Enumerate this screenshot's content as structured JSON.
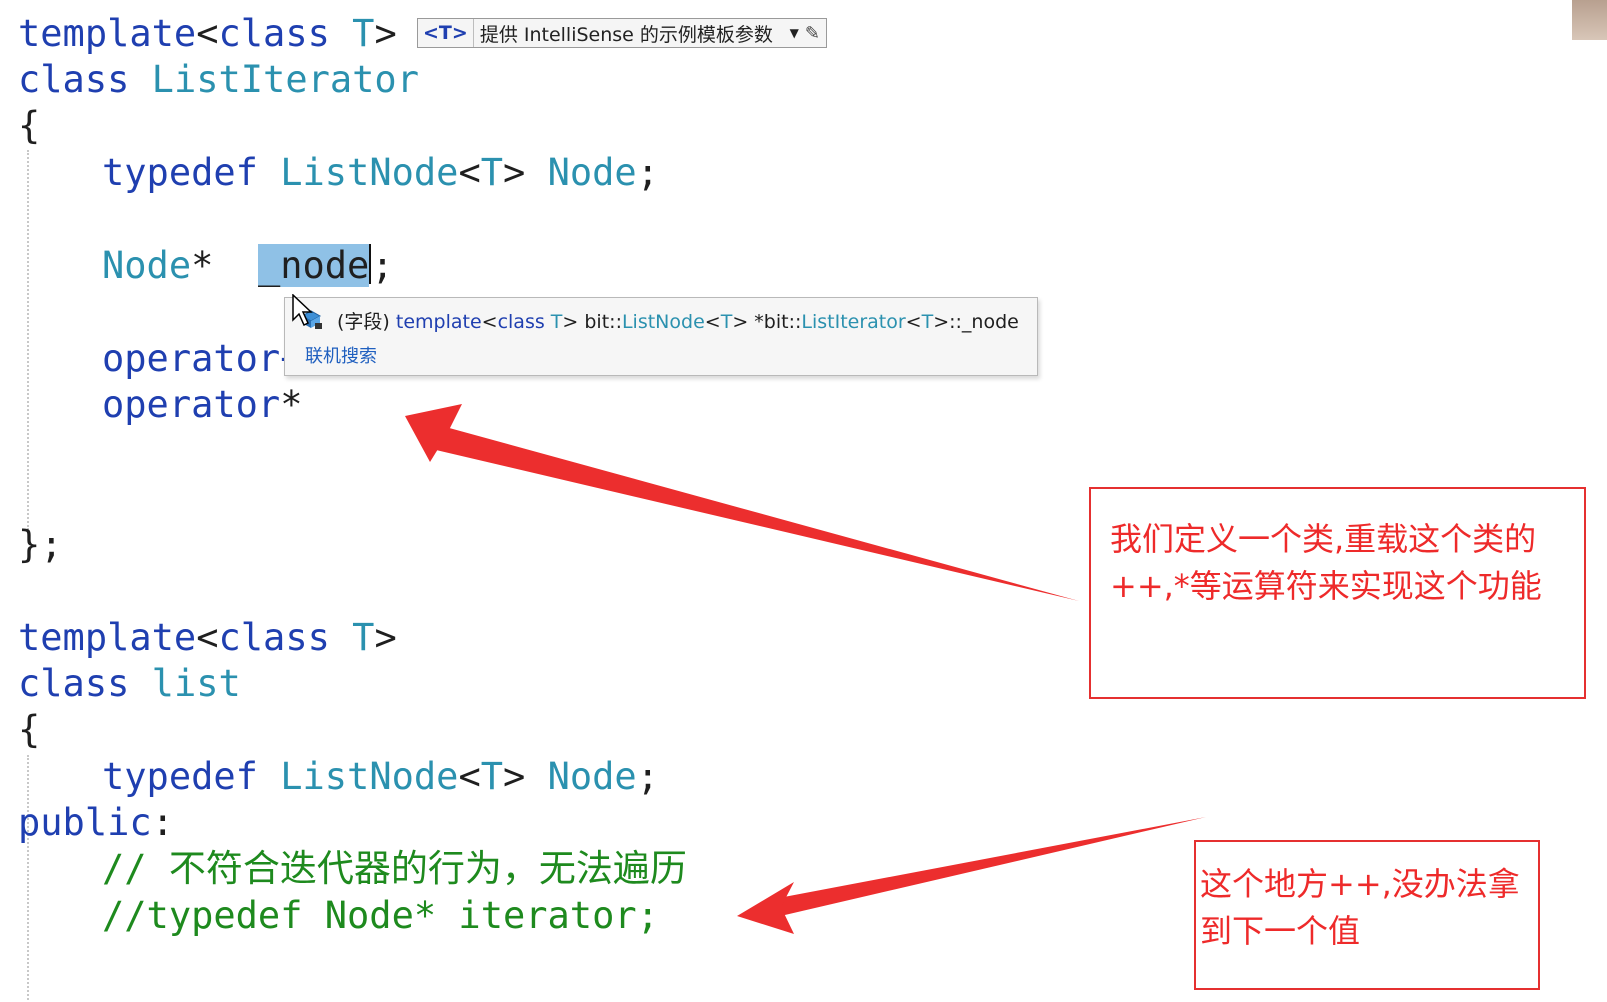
{
  "code_top": {
    "line1": {
      "kw": "template",
      "p1": "<",
      "kw2": "class",
      "sp": " ",
      "t": "T",
      "p2": ">"
    },
    "line2": {
      "kw": "class",
      "name": "ListIterator"
    },
    "line3": "{",
    "line4": {
      "kw": "typedef",
      "type": "ListNode",
      "p1": "<",
      "t": "T",
      "p2": ">",
      "name": "Node",
      "end": ";"
    },
    "line5": {
      "type": "Node",
      "star": "*",
      "field": "_node",
      "end": ";"
    },
    "line6": {
      "kw": "operator+",
      "rest": "+"
    },
    "line7": {
      "kw": "operator",
      "rest": "*"
    },
    "line8": "};"
  },
  "code_bottom": {
    "line1": {
      "kw": "template",
      "p1": "<",
      "kw2": "class",
      "t": "T",
      "p2": ">"
    },
    "line2": {
      "kw": "class",
      "name": "list"
    },
    "line3": "{",
    "line4": {
      "kw": "typedef",
      "type": "ListNode",
      "p1": "<",
      "t": "T",
      "p2": ">",
      "name": "Node",
      "end": ";"
    },
    "line5": {
      "kw": "public",
      "end": ":"
    },
    "line6": {
      "slashes": "// ",
      "text": "不符合迭代器的行为，无法遍历"
    },
    "line7": "//typedef Node* iterator;"
  },
  "template_bar": {
    "tag": "<T>",
    "text": "提供 IntelliSense 的示例模板参数",
    "dropdown_icon": "chevron-down-icon",
    "edit_icon": "pencil-icon"
  },
  "quick_info": {
    "kind": "(字段)",
    "sig_kw1": "template",
    "sig_p1": "<",
    "sig_kw2": "class",
    "sig_t1": "T",
    "sig_p2": ">",
    "sig_ns1": "bit::",
    "sig_type1": "ListNode",
    "sig_p3": "<",
    "sig_t2": "T",
    "sig_p4": ">",
    "sig_star": "*bit::",
    "sig_type2": "ListIterator",
    "sig_p5": "<",
    "sig_t3": "T",
    "sig_tail": ">::_node",
    "link": "联机搜索",
    "icon": "field-icon"
  },
  "annotations": {
    "box1": [
      "我们定义一个类,重载这个类的",
      "++,*等运算符来实现这个功能"
    ],
    "box2": [
      "这个地方++,没办法拿",
      "到下一个值"
    ]
  },
  "colors": {
    "keyword": "#1f3fb0",
    "type": "#2b91af",
    "comment": "#1e8a1e",
    "annotation": "#e53030",
    "selection": "#8fc1e6"
  }
}
